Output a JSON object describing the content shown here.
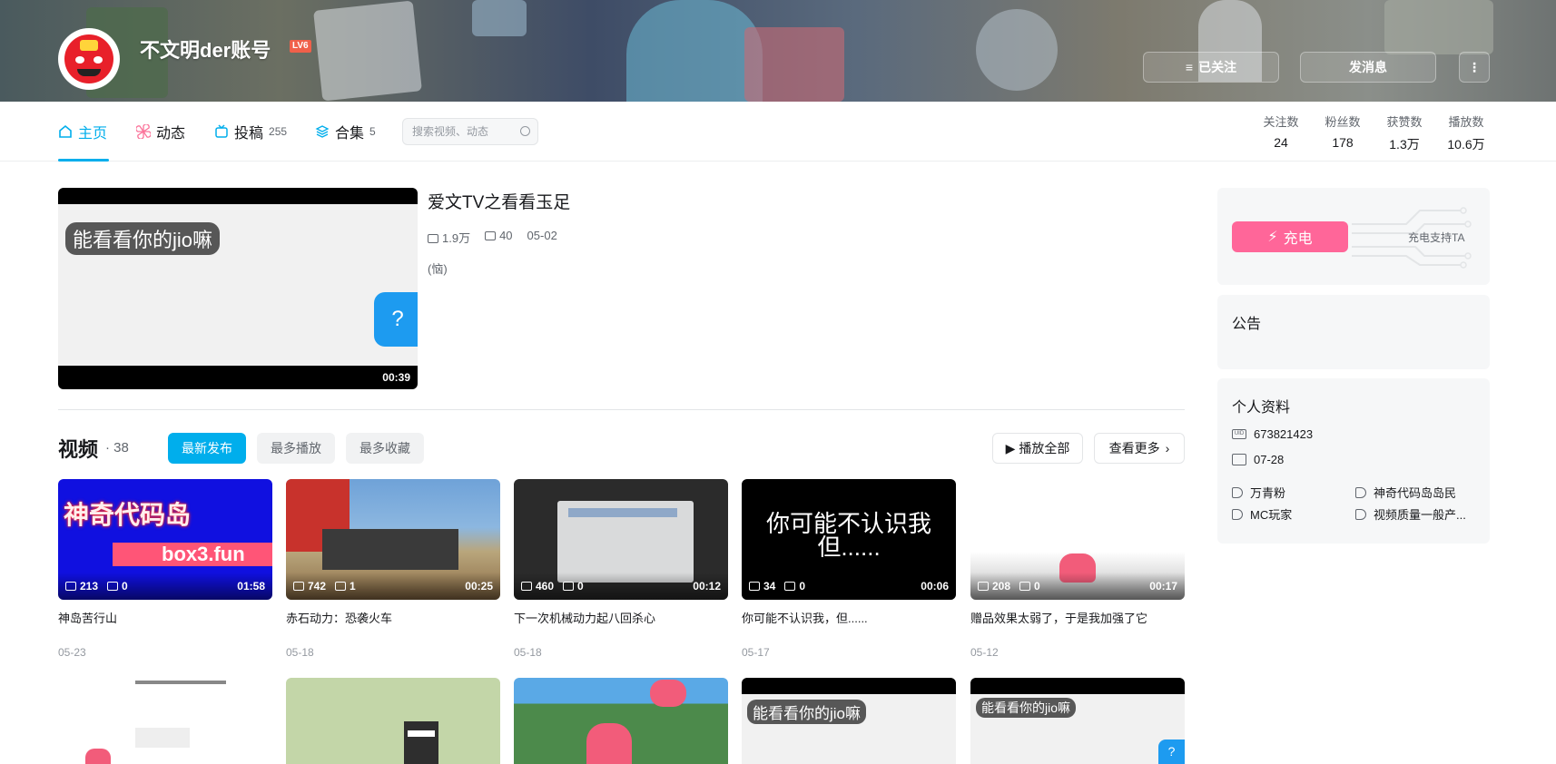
{
  "header": {
    "username": "不文明der账号",
    "level_badge": "LV6",
    "follow_button": "已关注",
    "message_button": "发消息"
  },
  "nav": {
    "tabs": [
      {
        "label": "主页",
        "count": ""
      },
      {
        "label": "动态",
        "count": ""
      },
      {
        "label": "投稿",
        "count": "255"
      },
      {
        "label": "合集",
        "count": "5"
      }
    ],
    "search_placeholder": "搜索视频、动态",
    "stats": [
      {
        "label": "关注数",
        "value": "24"
      },
      {
        "label": "粉丝数",
        "value": "178"
      },
      {
        "label": "获赞数",
        "value": "1.3万"
      },
      {
        "label": "播放数",
        "value": "10.6万"
      }
    ]
  },
  "featured": {
    "title": "爱文TV之看看玉足",
    "views": "1.9万",
    "comments": "40",
    "date": "05-02",
    "description": "(恼)",
    "duration": "00:39",
    "thumb_text": "能看看你的jio嘛",
    "thumb_bubble": "?"
  },
  "videos_section": {
    "title": "视频",
    "count": "· 38",
    "sort_tabs": [
      "最新发布",
      "最多播放",
      "最多收藏"
    ],
    "play_all": "播放全部",
    "see_more": "查看更多"
  },
  "videos": [
    {
      "title": "神岛苦行山",
      "date": "05-23",
      "views": "213",
      "danmaku": "0",
      "duration": "01:58",
      "thumb_text_1": "神奇代码岛",
      "thumb_text_2": "box3.fun"
    },
    {
      "title": "赤石动力：恐袭火车",
      "date": "05-18",
      "views": "742",
      "danmaku": "1",
      "duration": "00:25"
    },
    {
      "title": "下一次机械动力起八回杀心",
      "date": "05-18",
      "views": "460",
      "danmaku": "0",
      "duration": "00:12"
    },
    {
      "title": "你可能不认识我，但......",
      "date": "05-17",
      "views": "34",
      "danmaku": "0",
      "duration": "00:06",
      "thumb_text_1": "你可能不认识我",
      "thumb_text_2": "但......"
    },
    {
      "title": "赠品效果太弱了，于是我加强了它",
      "date": "05-12",
      "views": "208",
      "danmaku": "0",
      "duration": "00:17"
    }
  ],
  "row2_thumbs": [
    {
      "text": ""
    },
    {
      "text": ""
    },
    {
      "text": ""
    },
    {
      "text": "能看看你的jio嘛"
    },
    {
      "text": "能看看你的jio嘛",
      "bubble": "?"
    }
  ],
  "sidebar": {
    "charge_button": "充电",
    "charge_text": "充电支持TA",
    "notice_title": "公告",
    "profile_title": "个人资料",
    "uid": "673821423",
    "birthday": "07-28",
    "tags": [
      "万青粉",
      "神奇代码岛岛民",
      "MC玩家",
      "视频质量一般产..."
    ]
  },
  "colors": {
    "accent": "#00aeec",
    "charge": "#ff6699"
  }
}
